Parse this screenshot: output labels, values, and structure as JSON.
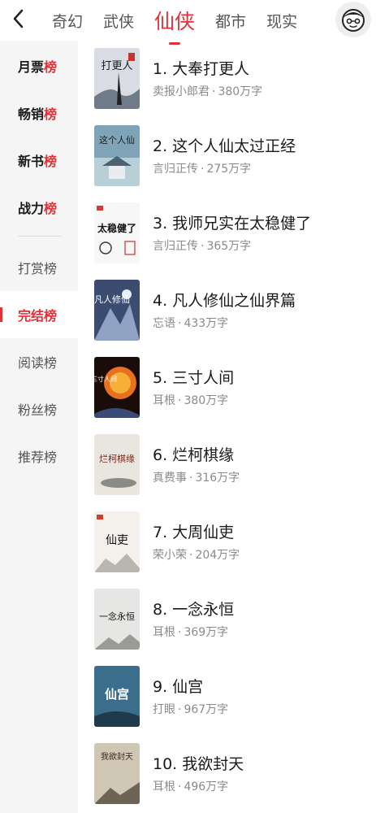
{
  "header": {
    "tabs": [
      {
        "label": "奇幻",
        "active": false
      },
      {
        "label": "武侠",
        "active": false
      },
      {
        "label": "仙侠",
        "active": true
      },
      {
        "label": "都市",
        "active": false
      },
      {
        "label": "现实",
        "active": false
      }
    ],
    "back_icon": "chevron-left-icon",
    "avatar_icon": "user-avatar-icon",
    "accent_color": "#e03238"
  },
  "sidebar": {
    "items": [
      {
        "prefix": "月票",
        "suffix": "榜"
      },
      {
        "prefix": "畅销",
        "suffix": "榜"
      },
      {
        "prefix": "新书",
        "suffix": "榜"
      },
      {
        "prefix": "战力",
        "suffix": "榜"
      },
      {
        "label": "打赏榜"
      },
      {
        "label": "完结榜",
        "active": true
      },
      {
        "label": "阅读榜"
      },
      {
        "label": "粉丝榜"
      },
      {
        "label": "推荐榜"
      }
    ]
  },
  "books": [
    {
      "title": "1. 大奉打更人",
      "author": "卖报小郎君",
      "words": "380万字",
      "cover_color": "#d9dde3",
      "cover_text": "打更人"
    },
    {
      "title": "2. 这个人仙太过正经",
      "author": "言归正传",
      "words": "275万字",
      "cover_color": "#7fa4b8",
      "cover_text": "这个人仙"
    },
    {
      "title": "3. 我师兄实在太稳健了",
      "author": "言归正传",
      "words": "365万字",
      "cover_color": "#f7f7f7",
      "cover_text": "太稳健了"
    },
    {
      "title": "4. 凡人修仙之仙界篇",
      "author": "忘语",
      "words": "433万字",
      "cover_color": "#3b4c70",
      "cover_text": "凡人修仙"
    },
    {
      "title": "5. 三寸人间",
      "author": "耳根",
      "words": "380万字",
      "cover_color": "#3a1a10",
      "cover_text": "三寸人间"
    },
    {
      "title": "6. 烂柯棋缘",
      "author": "真费事",
      "words": "316万字",
      "cover_color": "#e9e6e0",
      "cover_text": "烂柯棋缘"
    },
    {
      "title": "7. 大周仙吏",
      "author": "荣小荣",
      "words": "204万字",
      "cover_color": "#f4f1ed",
      "cover_text": "仙吏"
    },
    {
      "title": "8. 一念永恒",
      "author": "耳根",
      "words": "369万字",
      "cover_color": "#e6e6e4",
      "cover_text": "一念永恒"
    },
    {
      "title": "9. 仙宫",
      "author": "打眼",
      "words": "967万字",
      "cover_color": "#3b6e8c",
      "cover_text": "仙宫"
    },
    {
      "title": "10. 我欲封天",
      "author": "耳根",
      "words": "496万字",
      "cover_color": "#cfc6b4",
      "cover_text": "我欲封天"
    }
  ],
  "separator": "·"
}
